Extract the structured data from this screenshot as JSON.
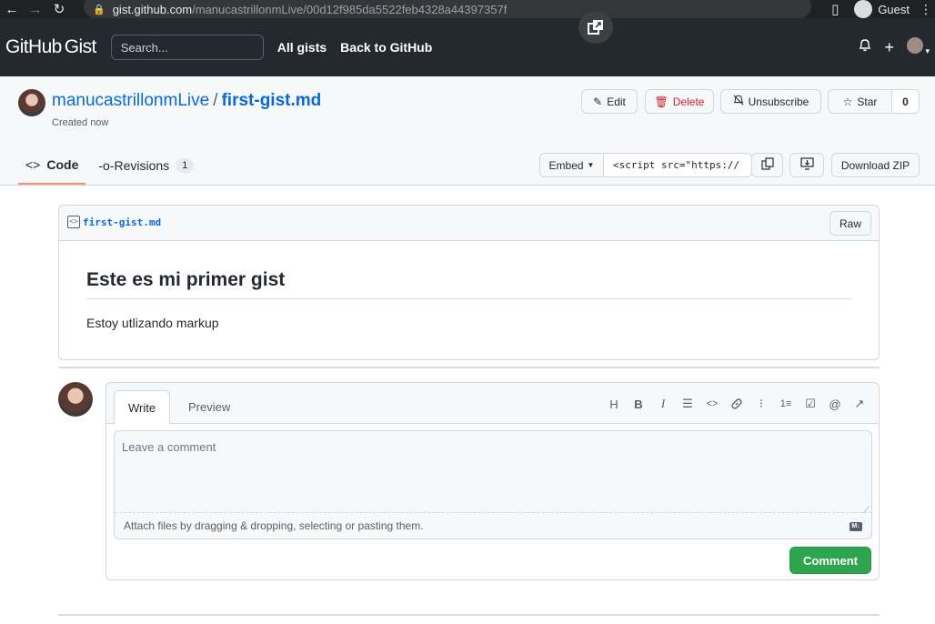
{
  "browser": {
    "url_host": "gist.github.com",
    "url_path": "/manucastrillonmLive/00d12f985da5522feb4328a44397357f",
    "profile": "Guest"
  },
  "header": {
    "logo_bold": "GitHub",
    "logo_light": "Gist",
    "search_placeholder": "Search...",
    "links": [
      "All gists",
      "Back to GitHub"
    ]
  },
  "gist": {
    "owner": "manucastrillonmLive",
    "separator": "/",
    "filename": "first-gist.md",
    "created": "Created now",
    "actions": {
      "edit": "Edit",
      "delete": "Delete",
      "unsubscribe": "Unsubscribe",
      "star": "Star",
      "star_count": "0"
    },
    "tabs": {
      "code": "Code",
      "revisions": "Revisions",
      "revisions_count": "1"
    },
    "embed": {
      "label": "Embed",
      "value": "<script src=\"https://"
    },
    "download": "Download ZIP"
  },
  "file": {
    "name": "first-gist.md",
    "raw": "Raw",
    "heading": "Este es mi primer gist",
    "paragraph": "Estoy utlizando markup"
  },
  "comment": {
    "tab_write": "Write",
    "tab_preview": "Preview",
    "placeholder": "Leave a comment",
    "attach_hint": "Attach files by dragging & dropping, selecting or pasting them.",
    "markdown_badge": "M↓",
    "submit": "Comment"
  }
}
